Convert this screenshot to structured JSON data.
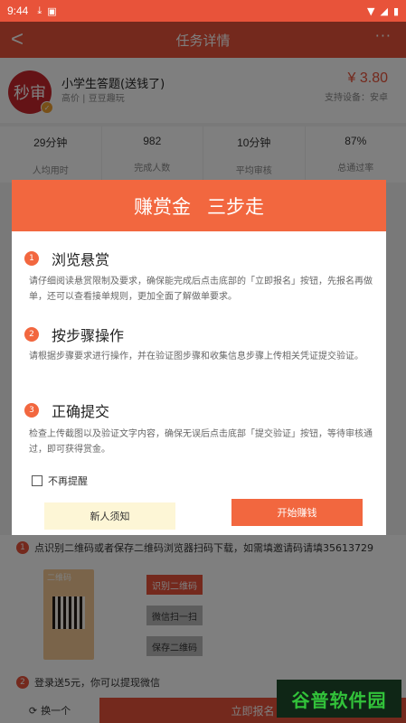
{
  "status_bar": {
    "time": "9:44"
  },
  "app_bar": {
    "title": "任务详情",
    "more": "···"
  },
  "task": {
    "logo_text": "秒审",
    "name": "小学生答题(送钱了)",
    "tags": "高价 | 豆豆趣玩",
    "price": "¥ 3.80",
    "device": "支持设备：安卓"
  },
  "stats": [
    {
      "value": "29分钟",
      "label": "人均用时"
    },
    {
      "value": "982",
      "label": "完成人数"
    },
    {
      "value": "10分钟",
      "label": "平均审核"
    },
    {
      "value": "87%",
      "label": "总通过率"
    }
  ],
  "modal": {
    "title_left": "赚赏金",
    "title_right": "三步走",
    "sections": [
      {
        "num": "1",
        "title": "浏览悬赏",
        "body": "请仔细阅读悬赏限制及要求，确保能完成后点击底部的「立即报名」按钮，先报名再做单，还可以查看接单规则，更加全面了解做单要求。"
      },
      {
        "num": "2",
        "title": "按步骤操作",
        "body": "请根据步骤要求进行操作，并在验证图步骤和收集信息步骤上传相关凭证提交验证。"
      },
      {
        "num": "3",
        "title": "正确提交",
        "body": "检查上传截图以及验证文字内容，确保无误后点击底部「提交验证」按钮，等待审核通过，即可获得赏金。"
      }
    ],
    "checkbox_label": "不再提醒",
    "btn_notice": "新人须知",
    "btn_start": "开始赚钱"
  },
  "steps": {
    "step1": "点识别二维码或者保存二维码浏览器扫码下载，如需填邀请码请填35613729",
    "qr_label": "二维码",
    "btn_identify": "识别二维码",
    "btn_scan": "微信扫一扫",
    "btn_save": "保存二维码",
    "step2": "登录送5元，你可以提现微信"
  },
  "bottom_bar": {
    "swap": "换一个",
    "signup": "立即报名"
  },
  "watermark": "谷普软件园",
  "colors": {
    "accent": "#e8533a",
    "modal_header": "#f2673f",
    "notice_button": "#fdf6d6"
  }
}
